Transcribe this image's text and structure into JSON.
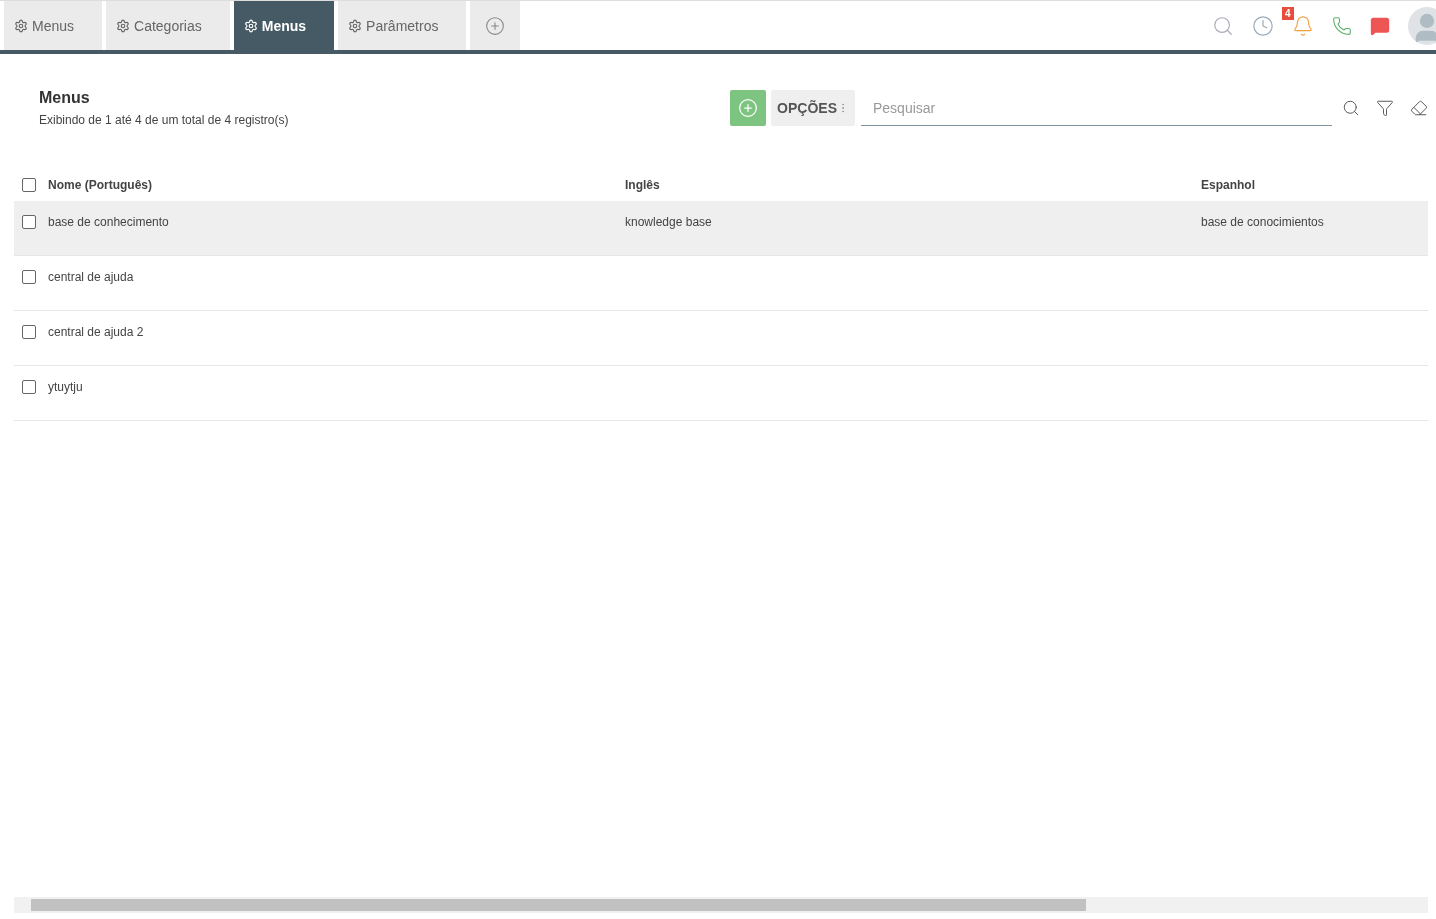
{
  "tabs": [
    {
      "label": "Menus",
      "selected": false
    },
    {
      "label": "Categorias",
      "selected": false
    },
    {
      "label": "Menus",
      "selected": true
    },
    {
      "label": "Parâmetros",
      "selected": false
    }
  ],
  "notifications": {
    "count": "4"
  },
  "header": {
    "title": "Menus",
    "subtitle": "Exibindo de 1 até 4 de um total de 4 registro(s)"
  },
  "toolbar": {
    "options_label": "OPÇÕES",
    "search": {
      "placeholder": "Pesquisar"
    }
  },
  "table": {
    "select_all": {
      "checked": false
    },
    "columns": [
      "Nome (Português)",
      "Inglês",
      "Espanhol"
    ],
    "rows": [
      {
        "selected": true,
        "checked": false,
        "cells": [
          "base de conhecimento",
          "knowledge base",
          "base de conocimientos"
        ]
      },
      {
        "selected": false,
        "checked": false,
        "cells": [
          "central de ajuda",
          "",
          ""
        ]
      },
      {
        "selected": false,
        "checked": false,
        "cells": [
          "central de ajuda 2",
          "",
          ""
        ]
      },
      {
        "selected": false,
        "checked": false,
        "cells": [
          "ytuytju",
          "",
          ""
        ]
      }
    ]
  }
}
